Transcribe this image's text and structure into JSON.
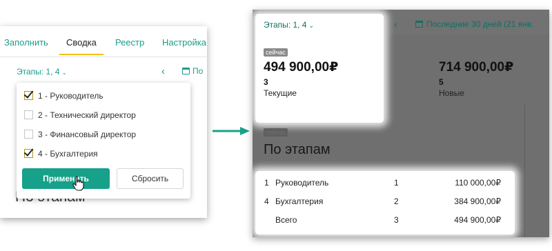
{
  "left": {
    "tabs": [
      "Заполнить",
      "Сводка",
      "Реестр",
      "Настройка"
    ],
    "stages_label": "Этапы: 1, 4",
    "nav_prev": "‹",
    "period_partial": "По",
    "options": [
      {
        "label": "1 - Руководитель",
        "checked": true
      },
      {
        "label": "2 - Технический директор",
        "checked": false
      },
      {
        "label": "3 - Финансовый директор",
        "checked": false
      },
      {
        "label": "4 - Бухгалтерия",
        "checked": true
      }
    ],
    "apply_label": "Применить",
    "reset_label": "Сбросить",
    "bg_title": "По этапам"
  },
  "right": {
    "stages_label": "Этапы: 1, 4",
    "nav_prev": "‹",
    "period": "Последние 30 дней (21 янв.",
    "badge": "сейчас",
    "current": {
      "amount": "494 900,00₽",
      "count": "3",
      "label": "Текущие"
    },
    "new": {
      "amount": "714 900,00₽",
      "count": "5",
      "label": "Новые"
    },
    "section_badge": "сейчас",
    "section_title": "По этапам",
    "rows": [
      {
        "num": "1",
        "name": "Руководитель",
        "count": "1",
        "sum": "110 000,00₽"
      },
      {
        "num": "4",
        "name": "Бухгалтерия",
        "count": "2",
        "sum": "384 900,00₽"
      },
      {
        "num": "",
        "name": "Всего",
        "count": "3",
        "sum": "494 900,00₽"
      }
    ]
  },
  "colors": {
    "accent": "#17a08a",
    "tab_underline": "#f2c20f",
    "dim_overlay": "#6f6f6f"
  }
}
